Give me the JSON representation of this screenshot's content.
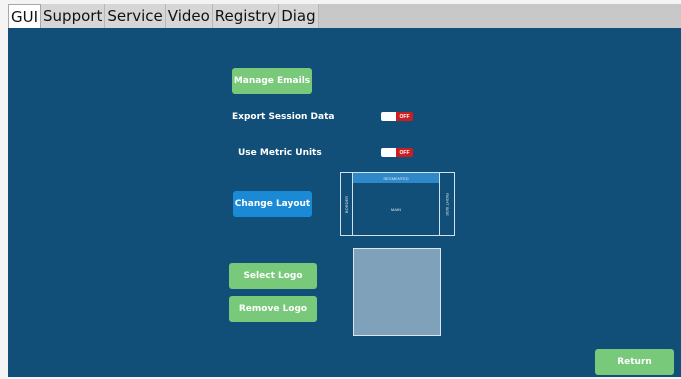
{
  "tabs": [
    {
      "label": "GUI",
      "active": true
    },
    {
      "label": "Support",
      "active": false
    },
    {
      "label": "Service",
      "active": false
    },
    {
      "label": "Video",
      "active": false
    },
    {
      "label": "Registry",
      "active": false
    },
    {
      "label": "Diag",
      "active": false
    }
  ],
  "settings": {
    "manage_emails_label": "Manage Emails",
    "export_session_data": {
      "label": "Export Session Data",
      "state": "OFF"
    },
    "use_metric_units": {
      "label": "Use Metric Units",
      "state": "OFF"
    },
    "change_layout_label": "Change Layout",
    "layout_preview": {
      "header": "SEGMENTED",
      "left": "BORDER",
      "main": "MAIN",
      "right": "RIGHT SIDE"
    },
    "select_logo_label": "Select Logo",
    "remove_logo_label": "Remove Logo"
  },
  "return_label": "Return",
  "colors": {
    "panel": "#124f78",
    "green_button": "#78c97a",
    "blue_button": "#1b8ad6",
    "toggle_off": "#c91f22"
  }
}
